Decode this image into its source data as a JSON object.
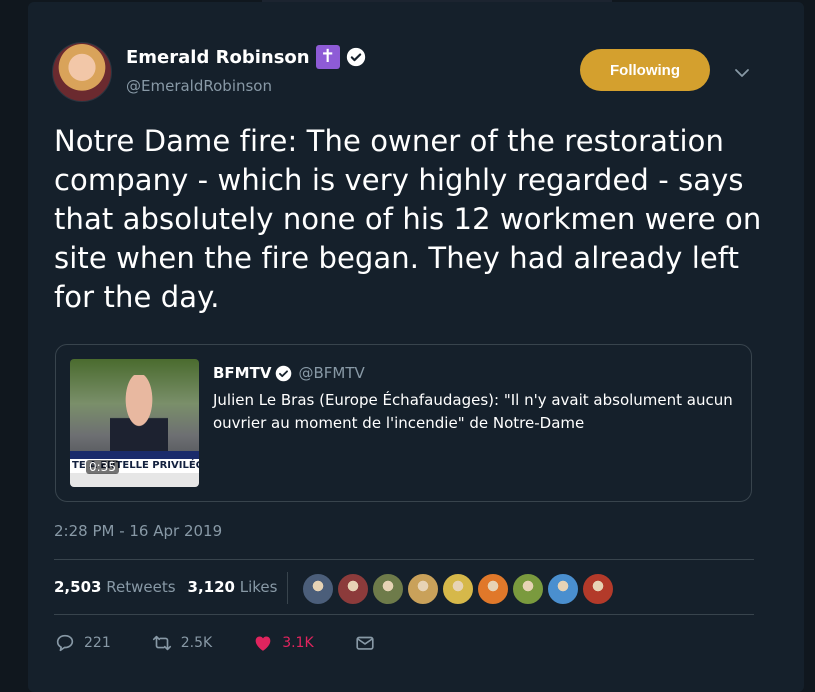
{
  "author": {
    "display_name": "Emerald Robinson",
    "badge_glyph": "✝",
    "handle": "@EmeraldRobinson"
  },
  "follow_button_label": "Following",
  "tweet_text": "Notre Dame fire: The owner of the restoration company - which is very highly regarded - says that absolutely none of his 12 workmen were on site when the fire began. They had already left for the day.",
  "quoted": {
    "name": "BFMTV",
    "handle": "@BFMTV",
    "text": "Julien Le Bras (Europe Échafaudages): \"Il n'y avait absolument aucun ouvrier au moment de l'incendie\" de Notre-Dame",
    "video_duration": "0:35",
    "ticker_text": "TE A   ENTELLE PRIVILÉGIÉE"
  },
  "timestamp": "2:28 PM - 16 Apr 2019",
  "stats": {
    "retweets_count": "2,503",
    "retweets_label": "Retweets",
    "likes_count": "3,120",
    "likes_label": "Likes"
  },
  "liker_avatar_colors": [
    "#4b5e7a",
    "#8c3b3b",
    "#6e7b4a",
    "#c9a15a",
    "#d6b84a",
    "#e0782a",
    "#7a9a3e",
    "#4a8fcf",
    "#b33a2a"
  ],
  "actions": {
    "replies": "221",
    "retweets": "2.5K",
    "likes": "3.1K"
  },
  "colors": {
    "accent_following": "#d4a02e",
    "like": "#e0245e",
    "muted_text": "#8899a6",
    "card_bg": "#15202b"
  }
}
